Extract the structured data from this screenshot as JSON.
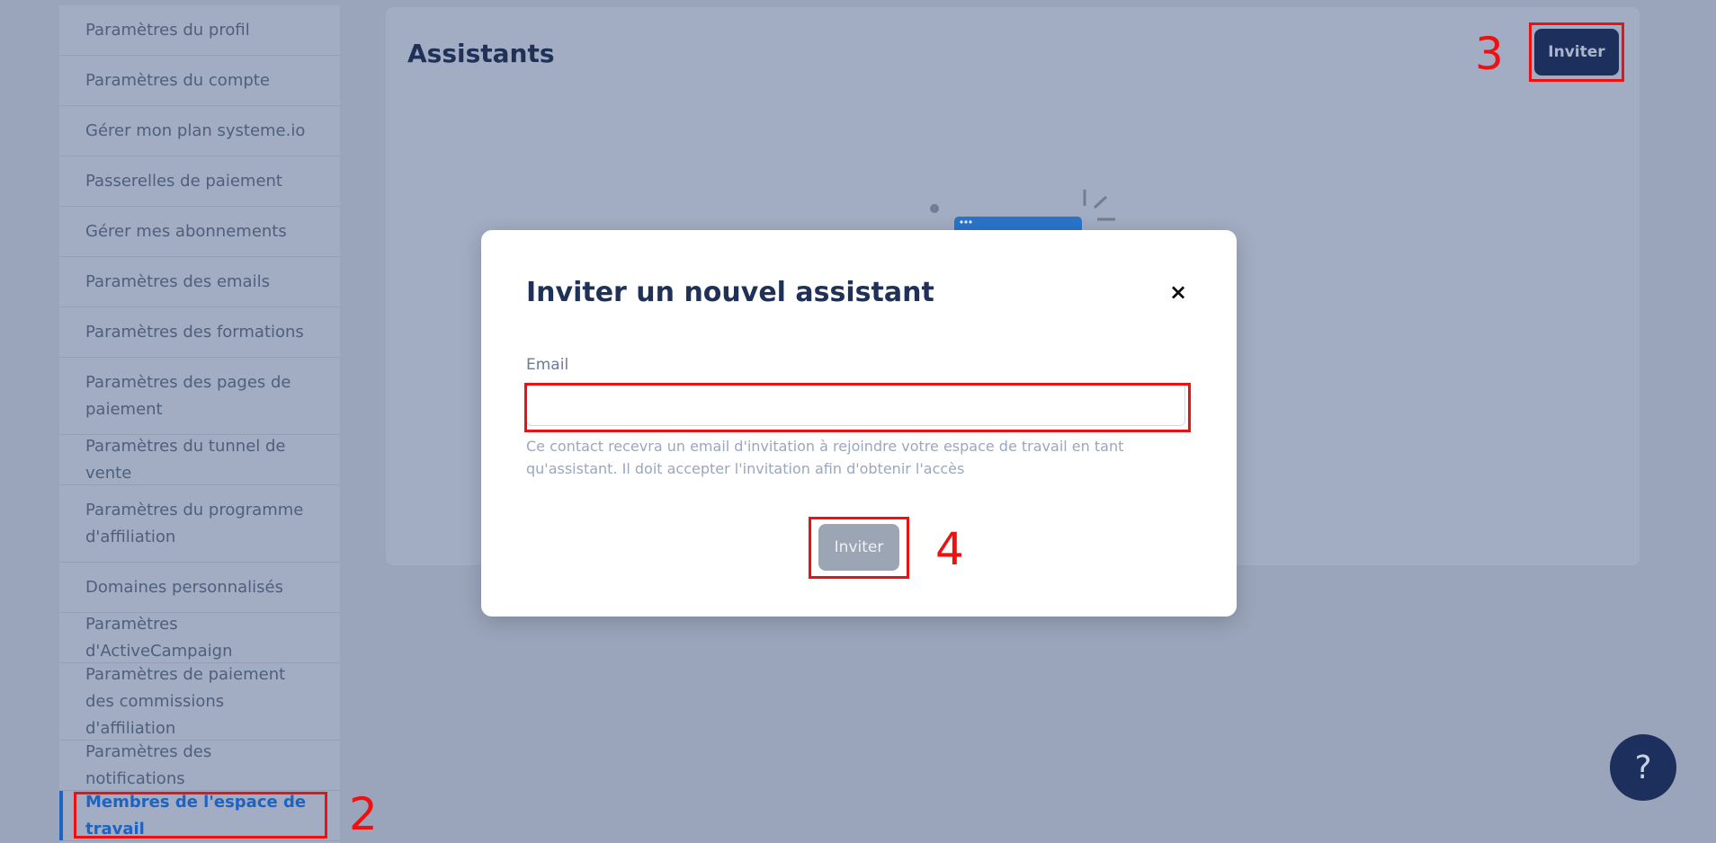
{
  "sidebar": {
    "items": [
      {
        "label": "Paramètres du profil"
      },
      {
        "label": "Paramètres du compte"
      },
      {
        "label": "Gérer mon plan systeme.io"
      },
      {
        "label": "Passerelles de paiement"
      },
      {
        "label": "Gérer mes abonnements"
      },
      {
        "label": "Paramètres des emails"
      },
      {
        "label": "Paramètres des formations"
      },
      {
        "label": "Paramètres des pages de paiement"
      },
      {
        "label": "Paramètres du tunnel de vente"
      },
      {
        "label": "Paramètres du programme d'affiliation"
      },
      {
        "label": "Domaines personnalisés"
      },
      {
        "label": "Paramètres d'ActiveCampaign"
      },
      {
        "label": "Paramètres de paiement des commissions d'affiliation"
      },
      {
        "label": "Paramètres des notifications"
      },
      {
        "label": "Membres de l'espace de travail",
        "active": true
      }
    ]
  },
  "main": {
    "title": "Assistants",
    "invite_label": "Inviter"
  },
  "modal": {
    "title": "Inviter un nouvel assistant",
    "close_icon": "×",
    "email_label": "Email",
    "email_value": "",
    "hint": "Ce contact recevra un email d'invitation à rejoindre votre espace de travail en tant qu'assistant. Il doit accepter l'invitation afin d'obtenir l'accès",
    "invite_label": "Inviter"
  },
  "help": {
    "icon": "question-icon",
    "glyph": "?"
  },
  "annotations": {
    "n2": "2",
    "n3": "3",
    "n4": "4",
    "color": "#ee1111"
  },
  "colors": {
    "accent": "#1d2f5c",
    "active_link": "#1d63c2",
    "annotation": "#ee1111"
  }
}
